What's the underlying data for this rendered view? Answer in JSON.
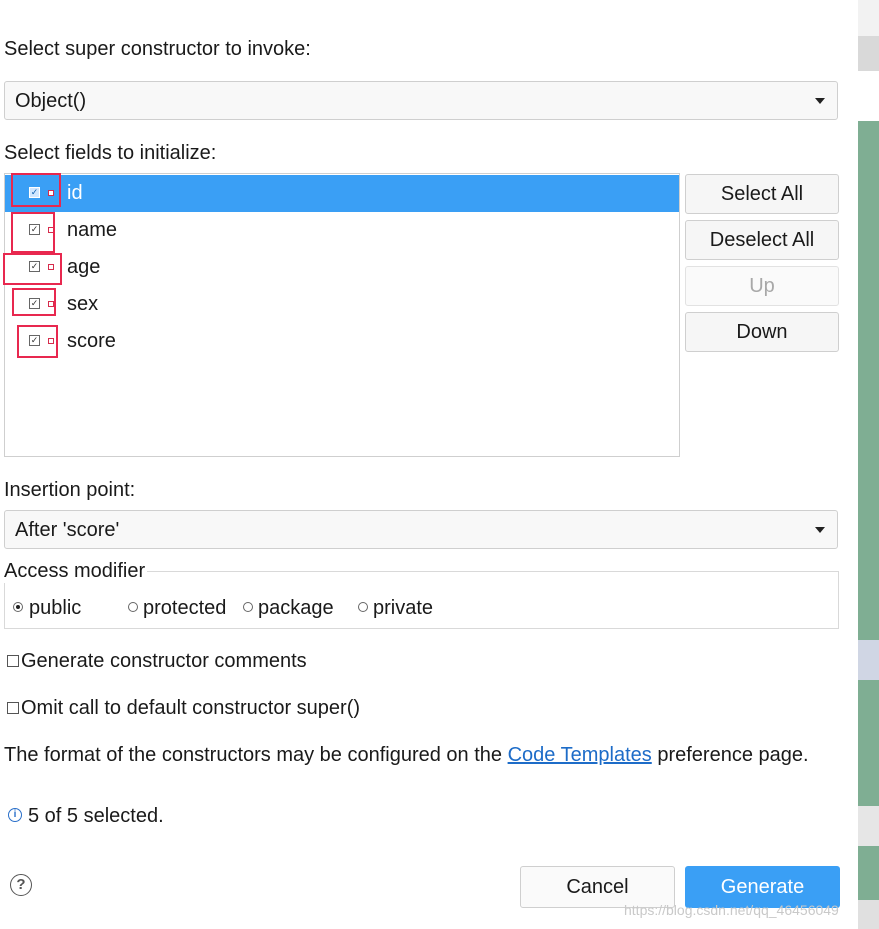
{
  "dialog": {
    "super_label": "Select super constructor to invoke:",
    "super_value": "Object()",
    "fields_label": "Select fields to initialize:",
    "fields": [
      {
        "name": "id",
        "checked": true,
        "selected": true
      },
      {
        "name": "name",
        "checked": true,
        "selected": false
      },
      {
        "name": "age",
        "checked": true,
        "selected": false
      },
      {
        "name": "sex",
        "checked": true,
        "selected": false
      },
      {
        "name": "score",
        "checked": true,
        "selected": false
      }
    ],
    "buttons": {
      "select_all": "Select All",
      "deselect_all": "Deselect All",
      "up": "Up",
      "down": "Down"
    },
    "insertion_label": "Insertion point:",
    "insertion_value": "After 'score'",
    "access_label": "Access modifier",
    "access_options": [
      "public",
      "protected",
      "package",
      "private"
    ],
    "access_selected": "public",
    "generate_comments": "Generate constructor comments",
    "omit_super": "Omit call to default constructor super()",
    "format_prefix": "The format of the constructors may be configured on the ",
    "format_link": "Code Templates",
    "format_suffix": " preference page.",
    "status": "5 of 5 selected.",
    "cancel": "Cancel",
    "generate": "Generate",
    "watermark": "https://blog.csdn.net/qq_46456049"
  },
  "colors": {
    "accent": "#3a9ff5",
    "highlight": "#e8284f",
    "side_panel": "#7fae93",
    "link": "#1d6cc8"
  }
}
